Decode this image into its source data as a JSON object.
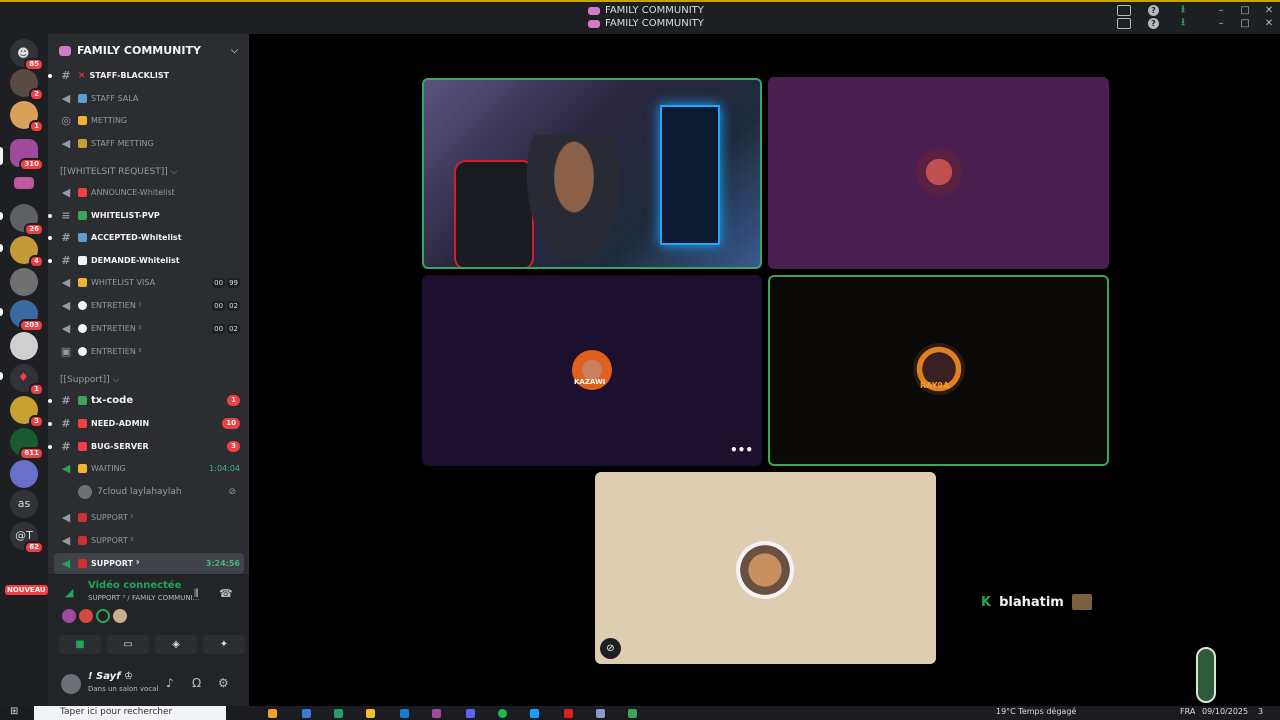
{
  "window": {
    "title_1": "FAMILY COMMUNITY",
    "title_2": "FAMILY COMMUNITY"
  },
  "rail": {
    "home_badge": "85",
    "servers": [
      {
        "badge": "2"
      },
      {
        "badge": "1"
      },
      {
        "badge": "310"
      },
      {
        "badge": ""
      },
      {
        "badge": "26"
      },
      {
        "badge": "4"
      },
      {
        "badge": ""
      },
      {
        "badge": "203"
      },
      {
        "badge": ""
      },
      {
        "badge": "1"
      },
      {
        "badge": "3"
      },
      {
        "badge": "611"
      },
      {
        "badge": ""
      }
    ],
    "text_server_1": "as",
    "text_server_2": "@T",
    "text_server_2_badge": "62",
    "new_label": "NOUVEAU"
  },
  "sidebar": {
    "server_name": "FAMILY COMMUNITY",
    "channels": [
      {
        "label": "STAFF-BLACKLIST"
      },
      {
        "label": "STAFF SALA"
      },
      {
        "label": "METTING"
      },
      {
        "label": "STAFF METTING"
      },
      {
        "label": "ANNOUNCE-Whitelist"
      },
      {
        "label": "WHITELIST-PVP"
      },
      {
        "label": "ACCEPTED-Whitelist"
      },
      {
        "label": "DEMANDE-Whitelist"
      },
      {
        "label": "WHITELIST VISA",
        "left": "00",
        "right": "99"
      },
      {
        "label": "ENTRETIEN ¹",
        "left": "00",
        "right": "02"
      },
      {
        "label": "ENTRETIEN ²",
        "left": "00",
        "right": "02"
      },
      {
        "label": "ENTRETIEN ³"
      },
      {
        "label": "tx-code",
        "count": "1"
      },
      {
        "label": "NEED-ADMIN",
        "count": "10"
      },
      {
        "label": "BUG-SERVER",
        "count": "3"
      },
      {
        "label": "WAITING",
        "timer": "1:04:04"
      },
      {
        "label": "SUPPORT ¹"
      },
      {
        "label": "SUPPORT ²"
      },
      {
        "label": "SUPPORT ³",
        "timer": "3:24:56"
      }
    ],
    "category_1": "[[WHITELSIT REQUEST]] ",
    "category_2": "[[Support]] ",
    "member_name": "7cloud laylahaylah"
  },
  "voice_panel": {
    "status": "Vidéo connectée",
    "location": "SUPPORT ³ / FAMILY COMMUNI..."
  },
  "user_panel": {
    "name": "! Sayf ♔",
    "status": "Dans un salon vocal"
  },
  "stage": {
    "side_user_name": "blahatim",
    "side_user_prefix": "K",
    "tile_3_label": "KAZAWI",
    "tile_4_label": "RAY9A"
  },
  "taskbar": {
    "search_placeholder": "Taper ici pour rechercher",
    "weather": "19°C  Temps dégagé",
    "lang": "FRA",
    "date": "09/10/2025",
    "notif": "3"
  },
  "colors": {
    "speaking_border": "#3ba55c",
    "tile_purple": "#4a1e4e",
    "tile_navy": "#1d0f2e",
    "tile_dark": "#0c0a08",
    "tile_beige": "#dfcdb1"
  }
}
